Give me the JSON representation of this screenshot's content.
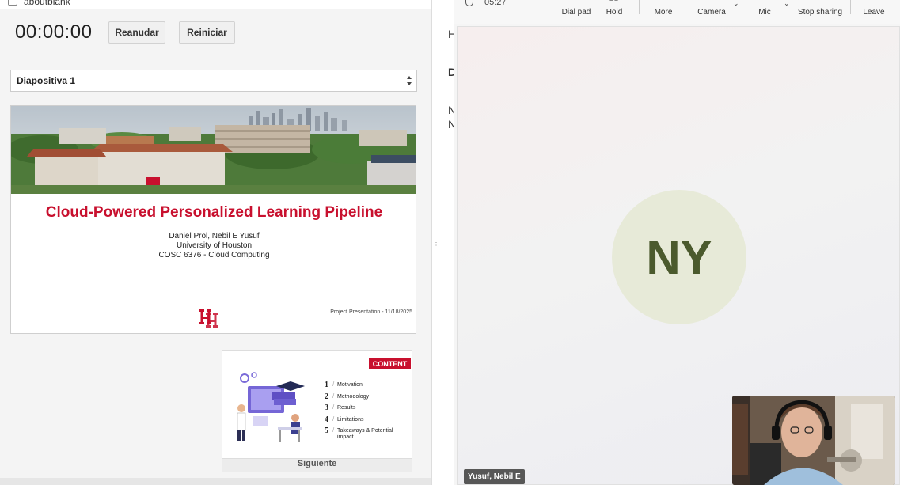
{
  "presenter": {
    "app_title": "aboutblank",
    "timer": "00:00:00",
    "resume_label": "Reanudar",
    "restart_label": "Reiniciar",
    "slide_select_value": "Diapositiva 1",
    "current_slide": {
      "title": "Cloud-Powered Personalized Learning Pipeline",
      "authors": "Daniel Prol, Nebil E Yusuf",
      "university": "University of Houston",
      "course": "COSC 6376 - Cloud Computing",
      "footer": "Project Presentation - 11/18/2025",
      "logo_text": "UH"
    },
    "next_slide": {
      "tag": "CONTENT",
      "items": [
        {
          "num": "1",
          "text": "Motivation"
        },
        {
          "num": "2",
          "text": "Methodology"
        },
        {
          "num": "3",
          "text": "Results"
        },
        {
          "num": "4",
          "text": "Limitations"
        },
        {
          "num": "5",
          "text": "Takeaways & Potential impact"
        }
      ]
    },
    "next_label": "Siguiente"
  },
  "notes_pane": {
    "letters": [
      "H",
      "D",
      "N",
      "N"
    ]
  },
  "teams": {
    "call_time": "05:27",
    "toolbar": {
      "dial_pad": "Dial pad",
      "hold": "Hold",
      "more": "More",
      "camera": "Camera",
      "mic": "Mic",
      "stop_sharing": "Stop sharing",
      "leave": "Leave"
    },
    "participant_initials": "NY",
    "participant_name": "Yusuf, Nebil E"
  },
  "colors": {
    "brand_red": "#c8102e",
    "avatar_bg": "#e7ead8",
    "avatar_text": "#4b5a2d",
    "leave_red": "#c4314b"
  }
}
